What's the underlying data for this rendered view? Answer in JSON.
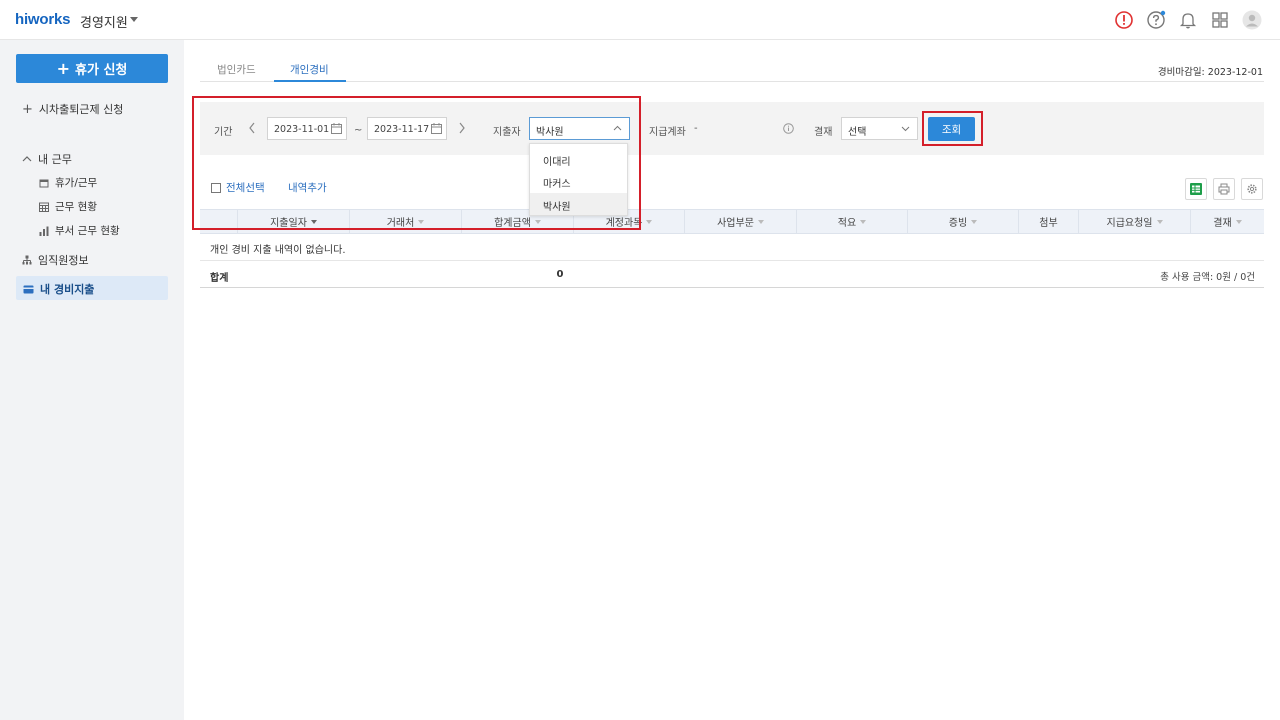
{
  "header": {
    "logo": "hiworks",
    "app_name": "경영지원"
  },
  "sidebar": {
    "primary_button": "휴가 신청",
    "flex_request": "시차출퇴근제 신청",
    "my_work": {
      "label": "내 근무",
      "items": [
        {
          "label": "휴가/근무",
          "icon": "calendar-icon"
        },
        {
          "label": "근무 현황",
          "icon": "grid-calendar-icon"
        },
        {
          "label": "부서 근무 현황",
          "icon": "bar-chart-icon"
        }
      ]
    },
    "employee_info": "임직원정보",
    "my_expense": "내 경비지출"
  },
  "tabs": [
    {
      "label": "법인카드",
      "active": false
    },
    {
      "label": "개인경비",
      "active": true
    }
  ],
  "deadline": "경비마감일: 2023-12-01",
  "filter": {
    "period_label": "기간",
    "start_date": "2023-11-01",
    "tilde": "~",
    "end_date": "2023-11-17",
    "spender_label": "지출자",
    "spender_value": "박사원",
    "spender_options": [
      "이대리",
      "마커스",
      "박사원"
    ],
    "account_label": "지급계좌",
    "account_value": "-",
    "approval_label": "결재",
    "approval_value": "선택",
    "query_button": "조회"
  },
  "actions": {
    "select_all": "전체선택",
    "add_row": "내역추가"
  },
  "table": {
    "columns": [
      "지출일자",
      "거래처",
      "합계금액",
      "계정과목",
      "사업부문",
      "적요",
      "증빙",
      "첨부",
      "지급요청일",
      "결재"
    ],
    "empty_message": "개인 경비 지출 내역이 없습니다.",
    "total_label": "합계",
    "total_value": "0",
    "total_summary": "총 사용 금액: 0원 / 0건"
  },
  "colors": {
    "accent": "#2c88d9",
    "highlight": "#d41f2a",
    "sidebar_bg": "#f2f3f5"
  }
}
